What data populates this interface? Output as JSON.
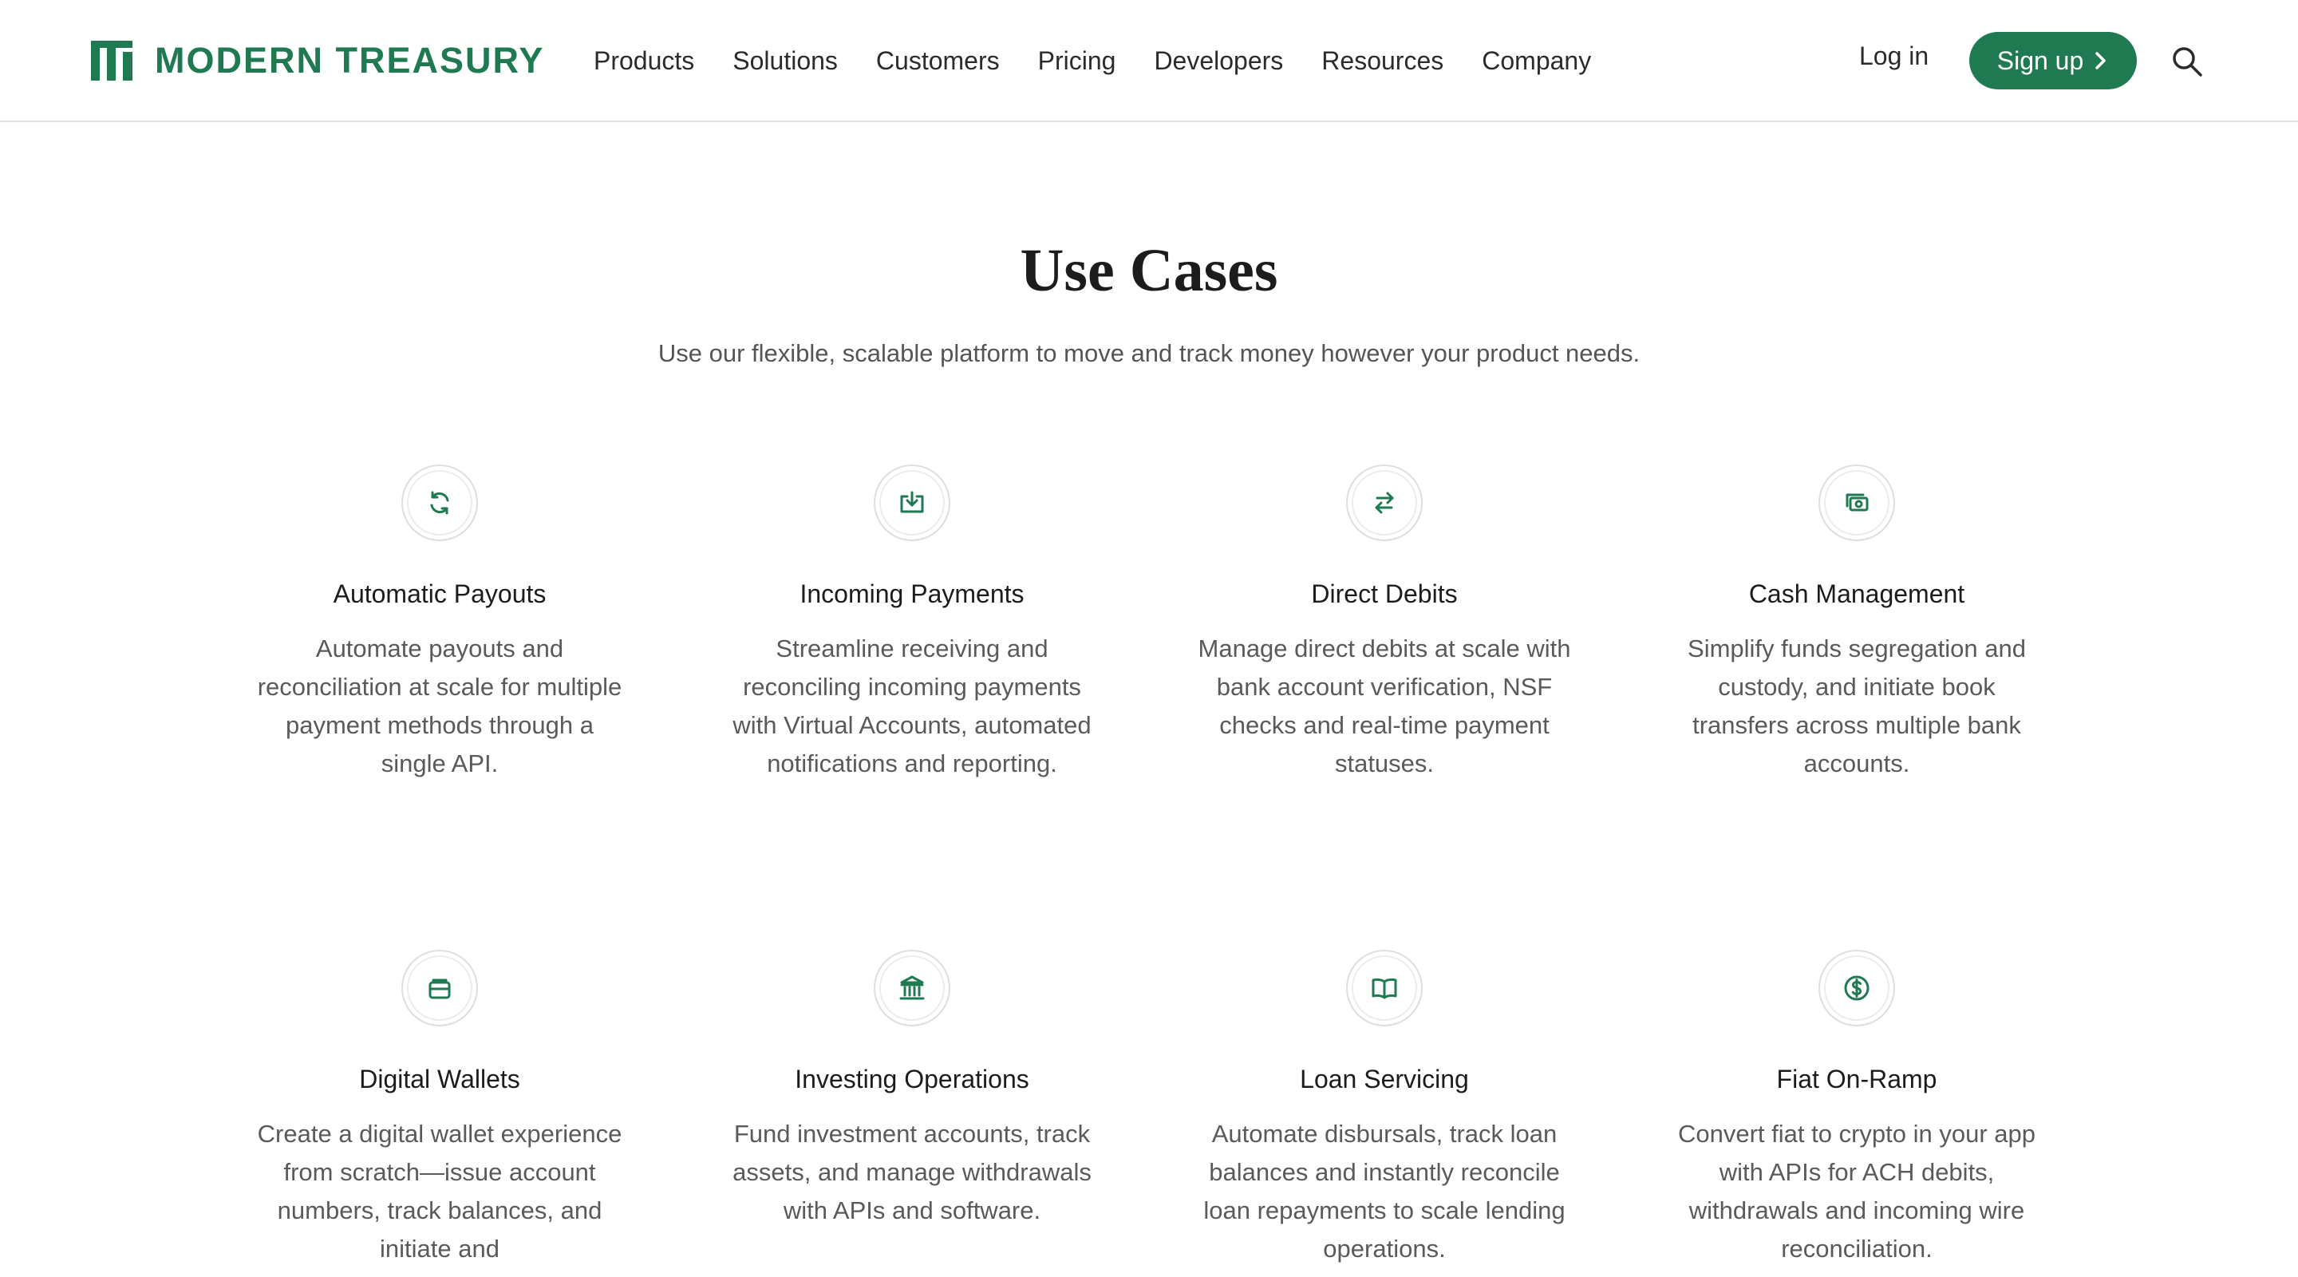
{
  "brand": {
    "name": "MODERN TREASURY",
    "color": "#1f7a52",
    "icon": "modern-treasury-logo"
  },
  "nav": {
    "items": [
      {
        "label": "Products",
        "key": "products"
      },
      {
        "label": "Solutions",
        "key": "solutions"
      },
      {
        "label": "Customers",
        "key": "customers"
      },
      {
        "label": "Pricing",
        "key": "pricing"
      },
      {
        "label": "Developers",
        "key": "developers"
      },
      {
        "label": "Resources",
        "key": "resources"
      },
      {
        "label": "Company",
        "key": "company"
      }
    ],
    "login_label": "Log in",
    "signup_label": "Sign up",
    "search_icon": "search-icon"
  },
  "section": {
    "title": "Use Cases",
    "subtitle": "Use our flexible, scalable platform to move and track money however your product needs."
  },
  "use_cases": [
    {
      "title": "Automatic Payouts",
      "icon": "refresh-icon",
      "description": "Automate payouts and reconciliation at scale for multiple payment methods through a single API."
    },
    {
      "title": "Incoming Payments",
      "icon": "inbox-download-icon",
      "description": "Streamline receiving and reconciling incoming payments with Virtual Accounts, automated notifications and reporting."
    },
    {
      "title": "Direct Debits",
      "icon": "transfer-arrows-icon",
      "description": "Manage direct debits at scale with bank account verification, NSF checks and real-time payment statuses."
    },
    {
      "title": "Cash Management",
      "icon": "cash-icon",
      "description": "Simplify funds segregation and custody, and initiate book transfers across multiple bank accounts."
    },
    {
      "title": "Digital Wallets",
      "icon": "wallet-icon",
      "description": "Create a digital wallet experience from scratch—issue account numbers, track balances, and initiate and"
    },
    {
      "title": "Investing Operations",
      "icon": "bank-building-icon",
      "description": "Fund investment accounts, track assets, and manage withdrawals with APIs and software."
    },
    {
      "title": "Loan Servicing",
      "icon": "open-book-icon",
      "description": "Automate disbursals, track loan balances and instantly reconcile loan repayments to scale lending operations."
    },
    {
      "title": "Fiat On-Ramp",
      "icon": "dollar-coin-icon",
      "description": "Convert fiat to crypto in your app with APIs for ACH debits, withdrawals and incoming wire reconciliation."
    }
  ]
}
